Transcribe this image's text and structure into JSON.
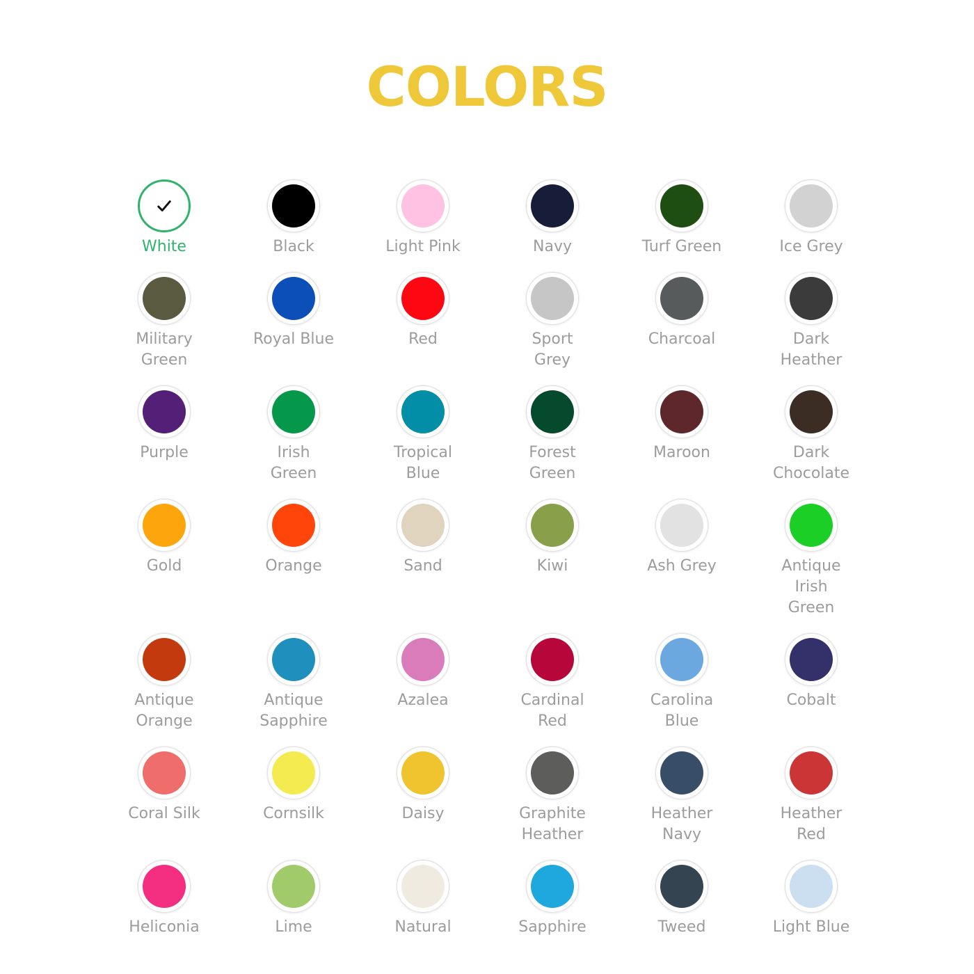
{
  "title": "COLORS",
  "accent_color": "#efc83a",
  "selected_color": "#2fb36c",
  "label_color": "#9c9c9c",
  "rows": [
    {
      "height": 133,
      "items": [
        {
          "label": "White",
          "color": "#ffffff",
          "selected": true,
          "icon": "check-icon"
        },
        {
          "label": "Black",
          "color": "#000000"
        },
        {
          "label": "Light Pink",
          "color": "#ffc2e3"
        },
        {
          "label": "Navy",
          "color": "#171c38"
        },
        {
          "label": "Turf Green",
          "color": "#1f4e13"
        },
        {
          "label": "Ice Grey",
          "color": "#d2d2d2"
        }
      ]
    },
    {
      "height": 163,
      "items": [
        {
          "label": "Military\nGreen",
          "color": "#595a3f"
        },
        {
          "label": "Royal Blue",
          "color": "#0c4fb8"
        },
        {
          "label": "Red",
          "color": "#fe0612"
        },
        {
          "label": "Sport\nGrey",
          "color": "#c6c6c6"
        },
        {
          "label": "Charcoal",
          "color": "#575b5b"
        },
        {
          "label": "Dark\nHeather",
          "color": "#3b3b3c"
        }
      ]
    },
    {
      "height": 163,
      "items": [
        {
          "label": "Purple",
          "color": "#542077"
        },
        {
          "label": "Irish\nGreen",
          "color": "#05984a"
        },
        {
          "label": "Tropical\nBlue",
          "color": "#028ea7"
        },
        {
          "label": "Forest\nGreen",
          "color": "#064a2d"
        },
        {
          "label": "Maroon",
          "color": "#5d272c"
        },
        {
          "label": "Dark\nChocolate",
          "color": "#3b2c24"
        }
      ]
    },
    {
      "height": 193,
      "items": [
        {
          "label": "Gold",
          "color": "#fda50c"
        },
        {
          "label": "Orange",
          "color": "#ff4509"
        },
        {
          "label": "Sand",
          "color": "#e0d4be"
        },
        {
          "label": "Kiwi",
          "color": "#89a04a"
        },
        {
          "label": "Ash Grey",
          "color": "#e2e2e2"
        },
        {
          "label": "Antique\nIrish\nGreen",
          "color": "#1bcf26"
        }
      ]
    },
    {
      "height": 163,
      "items": [
        {
          "label": "Antique\nOrange",
          "color": "#c33a0f"
        },
        {
          "label": "Antique\nSapphire",
          "color": "#1f8fbe"
        },
        {
          "label": "Azalea",
          "color": "#d97cb9"
        },
        {
          "label": "Cardinal\nRed",
          "color": "#b6063a"
        },
        {
          "label": "Carolina\nBlue",
          "color": "#6ba8df"
        },
        {
          "label": "Cobalt",
          "color": "#34306a"
        }
      ]
    },
    {
      "height": 163,
      "items": [
        {
          "label": "Coral Silk",
          "color": "#ef6e6b"
        },
        {
          "label": "Cornsilk",
          "color": "#f4eb51"
        },
        {
          "label": "Daisy",
          "color": "#f0c42e"
        },
        {
          "label": "Graphite\nHeather",
          "color": "#5d5e5c"
        },
        {
          "label": "Heather\nNavy",
          "color": "#384e68"
        },
        {
          "label": "Heather\nRed",
          "color": "#cb3536"
        }
      ]
    },
    {
      "height": 133,
      "items": [
        {
          "label": "Heliconia",
          "color": "#f32e80"
        },
        {
          "label": "Lime",
          "color": "#a1ca6a"
        },
        {
          "label": "Natural",
          "color": "#efebe0"
        },
        {
          "label": "Sapphire",
          "color": "#1ea8de"
        },
        {
          "label": "Tweed",
          "color": "#344450"
        },
        {
          "label": "Light Blue",
          "color": "#cbdff0"
        }
      ]
    }
  ]
}
